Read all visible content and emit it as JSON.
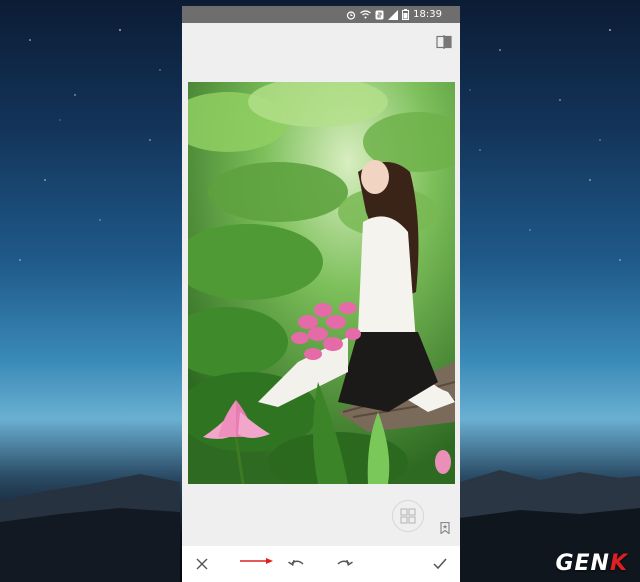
{
  "status_bar": {
    "time": "18:39"
  },
  "icons": {
    "compare": "compare-icon",
    "stack": "stack-icon",
    "bookmark": "bookmark-icon",
    "close": "close-icon",
    "undo": "undo-icon",
    "redo": "redo-icon",
    "apply": "check-icon"
  },
  "colors": {
    "accent": "#e02020",
    "status_bar_bg": "#6e6e6e",
    "app_bg": "#efefef"
  },
  "watermark": {
    "text_main": "GEN",
    "text_accent": "K"
  }
}
